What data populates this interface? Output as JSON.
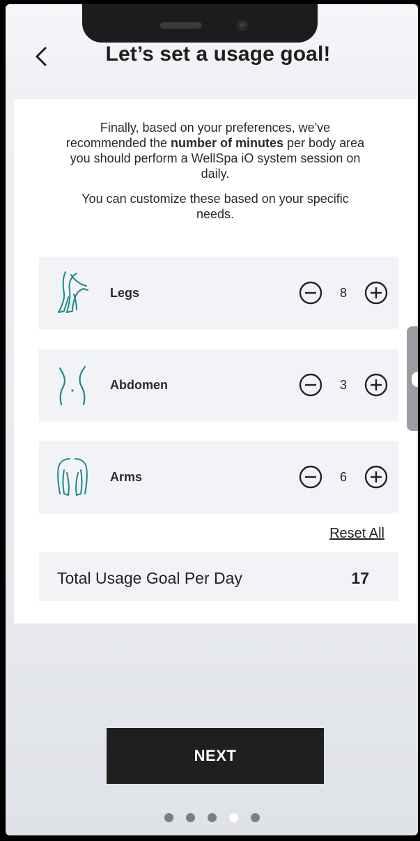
{
  "header": {
    "title": "Let’s set a usage goal!",
    "back_icon": "chevron-left-icon"
  },
  "intro": {
    "line1_before": "Finally, based on your preferences, we've recommended the ",
    "line1_bold": "number of minutes",
    "line1_after": " per body area you should perform a WellSpa iO system session on daily.",
    "line2": "You can customize these based on your specific needs."
  },
  "areas": [
    {
      "label": "Legs",
      "value": "8",
      "icon": "legs-icon"
    },
    {
      "label": "Abdomen",
      "value": "3",
      "icon": "abdomen-icon"
    },
    {
      "label": "Arms",
      "value": "6",
      "icon": "arms-icon"
    }
  ],
  "reset_label": "Reset All",
  "total": {
    "label": "Total Usage Goal Per Day",
    "value": "17"
  },
  "next_label": "NEXT",
  "pagination": {
    "total": 5,
    "active_index": 3
  },
  "colors": {
    "accent": "#1a8a8c",
    "button_bg": "#1f1f1f",
    "row_bg": "#f2f3f6"
  }
}
